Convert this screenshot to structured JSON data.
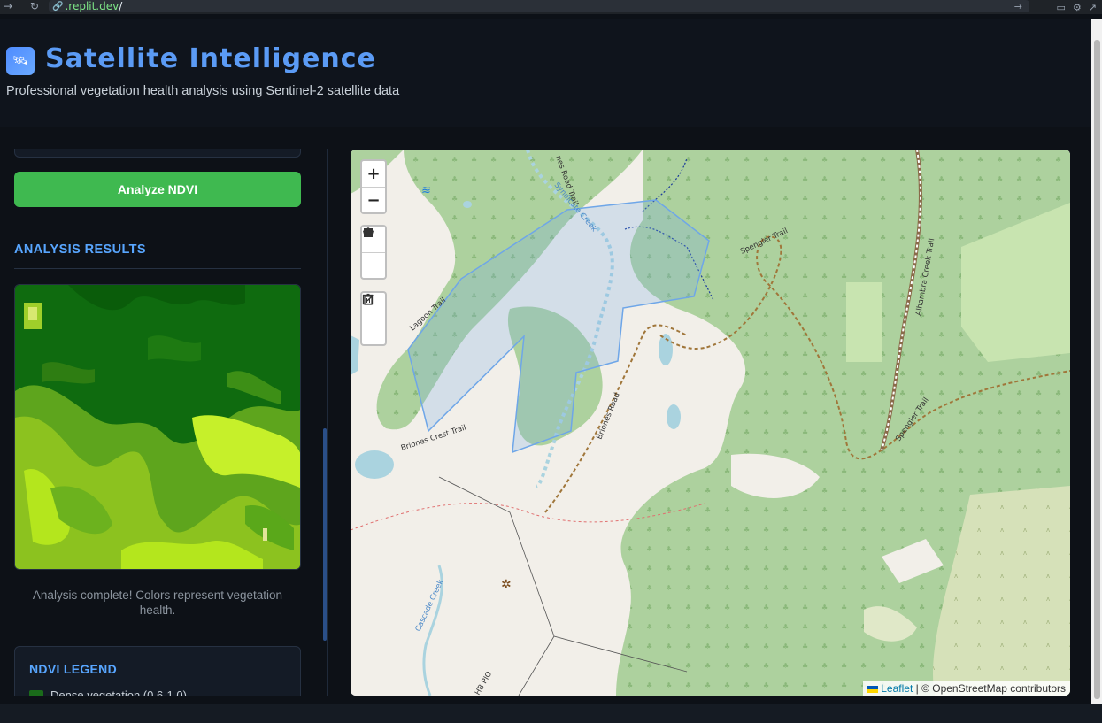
{
  "browser": {
    "url_host": ".replit.dev",
    "url_path": "/"
  },
  "header": {
    "title": "Satellite Intelligence",
    "subtitle": "Professional vegetation health analysis using Sentinel-2 satellite data"
  },
  "sidebar": {
    "analyze_button": "Analyze NDVI",
    "results_heading": "ANALYSIS RESULTS",
    "analysis_message": "Analysis complete! Colors represent vegetation health.",
    "legend": {
      "title": "NDVI LEGEND",
      "items": [
        {
          "label": "Dense vegetation (0.6-1.0)",
          "color": "#1a6b1a"
        }
      ]
    }
  },
  "map": {
    "zoom_in": "+",
    "zoom_out": "−",
    "draw_tools": [
      "polygon-icon",
      "rectangle-icon"
    ],
    "edit_tools": [
      "edit-icon",
      "trash-icon"
    ],
    "attribution_leaflet": "Leaflet",
    "attribution_rest": "| © OpenStreetMap contributors",
    "labels": {
      "road_trail": "nes Road Trail",
      "syndicate_creek": "Syndicate Creek",
      "lagoon_trail": "Lagoon Trail",
      "briones_crest": "Briones Crest Trail",
      "briones_road": "Briones Road",
      "spengler_top": "Spengler Trail",
      "spengler_bottom": "Spengler Trail",
      "alhambra_creek": "Alhambra Creek Trail",
      "cascade_creek": "Cascade Creek",
      "bottom_label": "HB PIO"
    }
  },
  "colors": {
    "accent": "#5b9bf5",
    "success": "#3fb950",
    "map_forest": "#add19e",
    "map_land": "#f2efe9"
  }
}
